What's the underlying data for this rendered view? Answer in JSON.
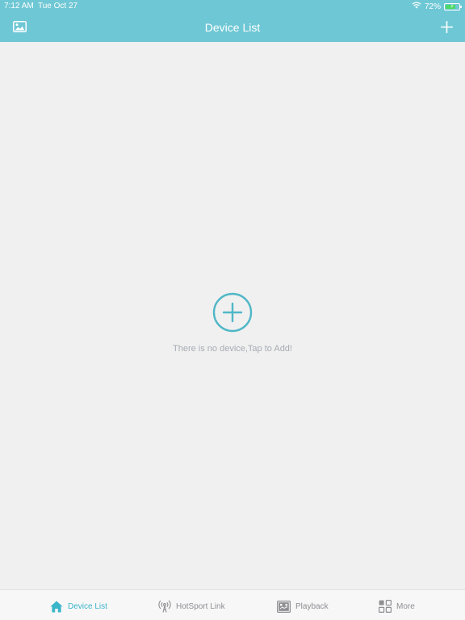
{
  "status_bar": {
    "time": "7:12 AM",
    "date": "Tue Oct 27",
    "battery_percent": "72%",
    "battery_level": 0.72,
    "icons": [
      "wifi-icon",
      "battery-icon"
    ]
  },
  "header": {
    "title": "Device List",
    "left_icon": "gallery-icon",
    "right_icon": "plus-icon",
    "background_color": "#6ec7d4"
  },
  "main": {
    "empty_icon": "add-circle-icon",
    "empty_message": "There is no device,Tap to Add!",
    "accent_color": "#4fb7c7"
  },
  "tabbar": {
    "tabs": [
      {
        "label": "Device List",
        "icon": "home-icon",
        "active": true
      },
      {
        "label": "HotSport Link",
        "icon": "antenna-icon",
        "active": false
      },
      {
        "label": "Playback",
        "icon": "playback-icon",
        "active": false
      },
      {
        "label": "More",
        "icon": "grid-icon",
        "active": false
      }
    ],
    "active_color": "#3ab5ca",
    "inactive_color": "#8e8e93"
  }
}
